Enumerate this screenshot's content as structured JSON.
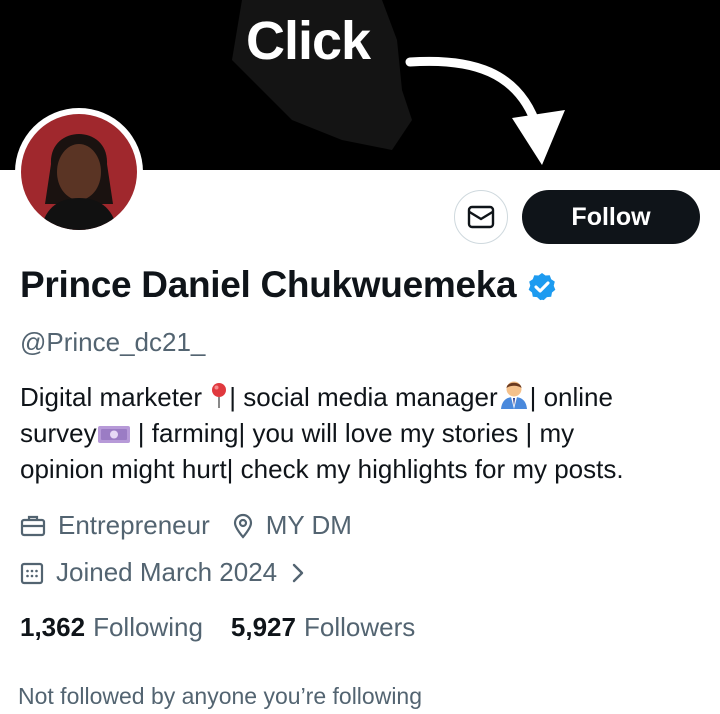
{
  "banner": {
    "overlay_text": "Click"
  },
  "profile": {
    "name": "Prince Daniel Chukwuemeka",
    "handle": "@Prince_dc21_",
    "bio": {
      "line1_a": "Digital marketer ",
      "line1_b": "| social media manager",
      "line1_c": "| online",
      "line2_a": "survey",
      "line2_b": " | farming| you will love my stories | my",
      "line3": "opinion might hurt| check my highlights for my posts."
    },
    "profession": "Entrepreneur",
    "location": "MY DM",
    "joined": "Joined March 2024",
    "following_count": "1,362",
    "following_label": "Following",
    "followers_count": "5,927",
    "followers_label": "Followers",
    "mutuals_note": "Not followed by anyone you’re following"
  },
  "actions": {
    "follow_label": "Follow",
    "message_icon": "envelope-icon"
  },
  "icons": {
    "verified": "verified-badge-icon",
    "profession": "briefcase-icon",
    "location": "location-pin-icon",
    "joined": "calendar-icon",
    "joined_more": "chevron-right-icon"
  },
  "colors": {
    "accent": "#1d9bf0",
    "primary_text": "#0f1419",
    "secondary_text": "#536471",
    "follow_bg": "#0f1419"
  }
}
